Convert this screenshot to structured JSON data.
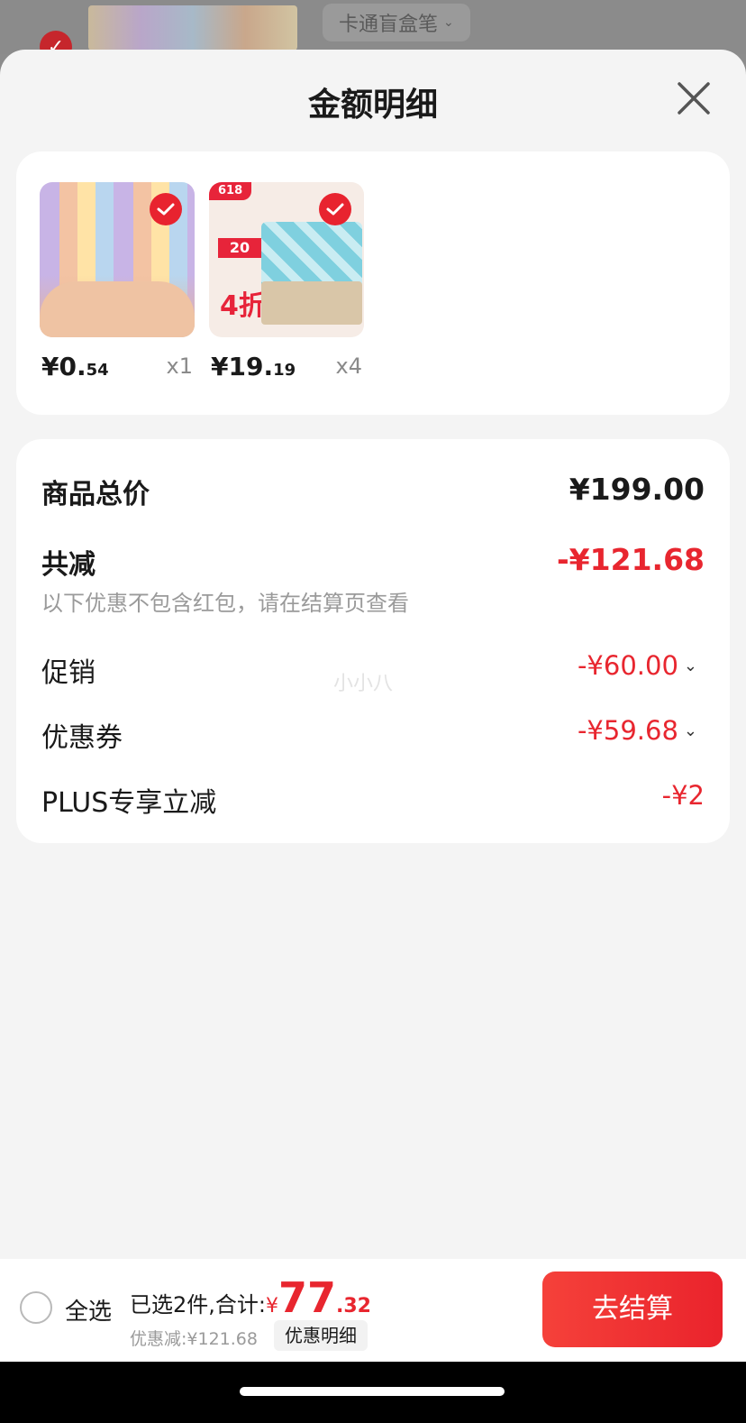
{
  "background": {
    "variant_label": "卡通盲盒笔"
  },
  "sheet": {
    "title": "金额明细"
  },
  "products": [
    {
      "price_main": "¥0.",
      "price_decimal": "54",
      "qty": "x1",
      "image": "cartoon-pens"
    },
    {
      "price_main": "¥19.",
      "price_decimal": "19",
      "qty": "x4",
      "image": "tissue-pack",
      "badge": "618",
      "promo_tag": "20",
      "promo_discount": "4折"
    }
  ],
  "summary": {
    "total_label": "商品总价",
    "total_value": "¥199.00",
    "reduction_label": "共减",
    "reduction_value": "-¥121.68",
    "hint": "以下优惠不包含红包，请在结算页查看",
    "rows": [
      {
        "label": "促销",
        "value": "-¥60.00"
      },
      {
        "label": "优惠券",
        "value": "-¥59.68"
      },
      {
        "label": "PLUS专享立减",
        "value": "-¥2"
      }
    ],
    "watermark": "小小八"
  },
  "bottom_bar": {
    "select_all": "全选",
    "selected_text": "已选2件,合计:",
    "currency": "¥",
    "total_int": "77",
    "total_dec": ".32",
    "discount_text": "优惠减:¥121.68",
    "detail_button": "优惠明细",
    "checkout_button": "去结算"
  },
  "colors": {
    "accent_red": "#e8262f",
    "sheet_bg": "#f4f4f4",
    "card_bg": "#ffffff"
  }
}
